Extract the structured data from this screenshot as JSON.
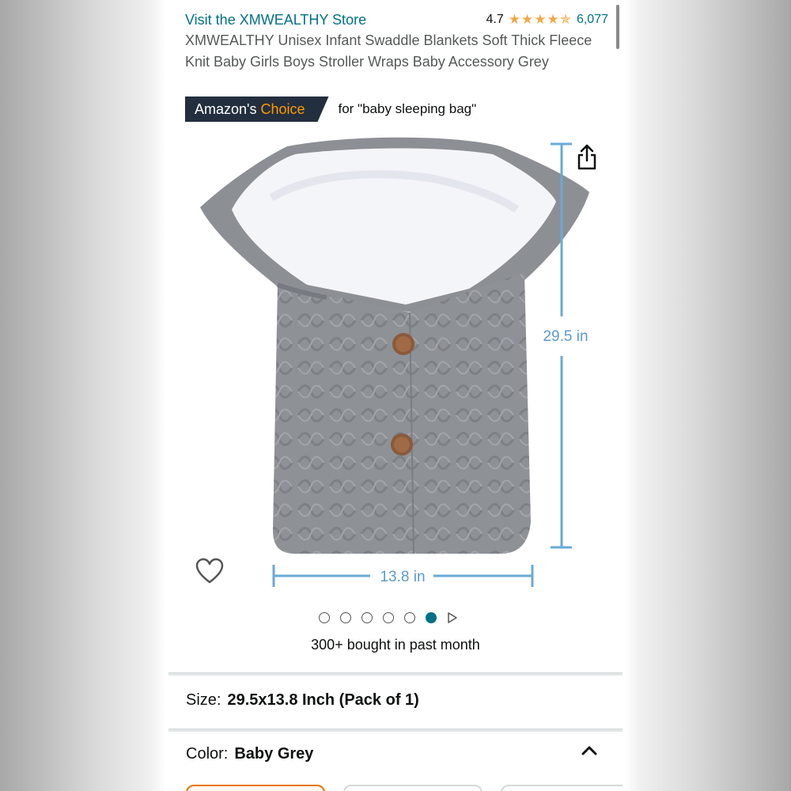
{
  "store": {
    "link_text": "Visit the XMWEALTHY Store"
  },
  "rating": {
    "value": "4.7",
    "stars": "★★★★✯",
    "stars_fraction": 0.94,
    "count": "6,077"
  },
  "product": {
    "title": "XMWEALTHY Unisex Infant Swaddle Blankets Soft Thick Fleece Knit Baby Girls Boys Stroller Wraps Baby Accessory Grey"
  },
  "badge": {
    "prefix": "Amazon's",
    "highlight": "Choice",
    "for_text": "for \"baby sleeping bag\""
  },
  "image": {
    "height_label": "29.5 in",
    "width_label": "13.8 in"
  },
  "carousel": {
    "total": 6,
    "active_index": 5
  },
  "bought_text": "300+ bought in past month",
  "size": {
    "label": "Size:",
    "value": "29.5x13.8 Inch (Pack of 1)"
  },
  "color": {
    "label": "Color:",
    "value": "Baby Grey"
  },
  "icons": [
    "share-icon",
    "heart-icon",
    "chevron-up-icon",
    "play-icon"
  ],
  "colors": {
    "link": "#007185",
    "star": "#f3a847",
    "badge_bg": "#232f3e",
    "badge_accent": "#ff9900",
    "dimension": "#6aaad8",
    "knit": "#8e9196"
  }
}
